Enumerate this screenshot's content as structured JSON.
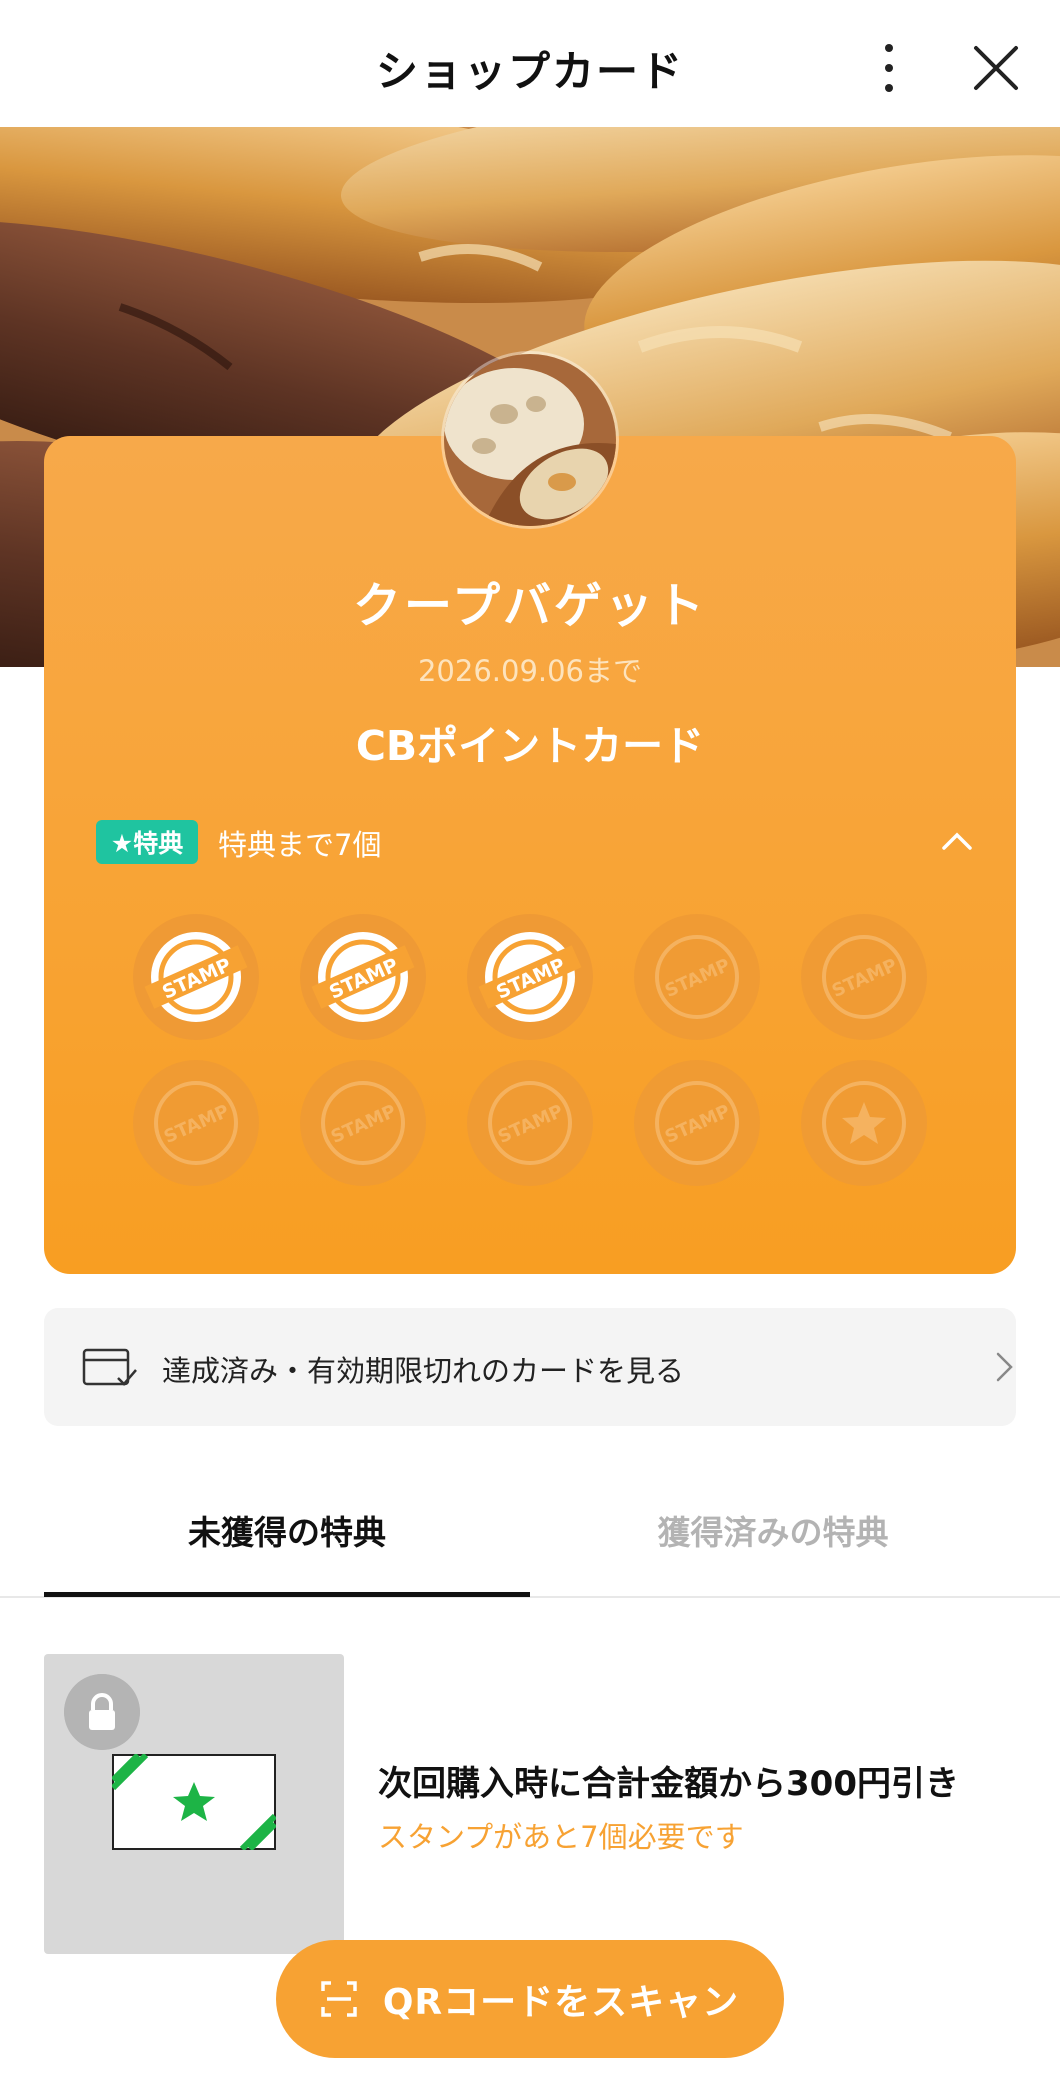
{
  "header": {
    "title": "ショップカード"
  },
  "shop": {
    "name": "クープバゲット",
    "expiry": "2026.09.06まで",
    "card_name": "CBポイントカード"
  },
  "reward_progress": {
    "badge": "★特典",
    "count_text": "特典まで7個"
  },
  "stamps": {
    "total": 10,
    "collected": 3,
    "stamp_text": "STAMP"
  },
  "history_link": {
    "label": "達成済み・有効期限切れのカードを見る"
  },
  "tabs": {
    "unclaimed": "未獲得の特典",
    "claimed": "獲得済みの特典"
  },
  "reward": {
    "title": "次回購入時に合計金額から300円引き",
    "requirement": "スタンプがあと7個必要です"
  },
  "scan_button": {
    "label": "QRコードをスキャン"
  },
  "colors": {
    "accent": "#f7a233",
    "badge": "#1fc4a0",
    "coupon_star": "#1db446"
  }
}
